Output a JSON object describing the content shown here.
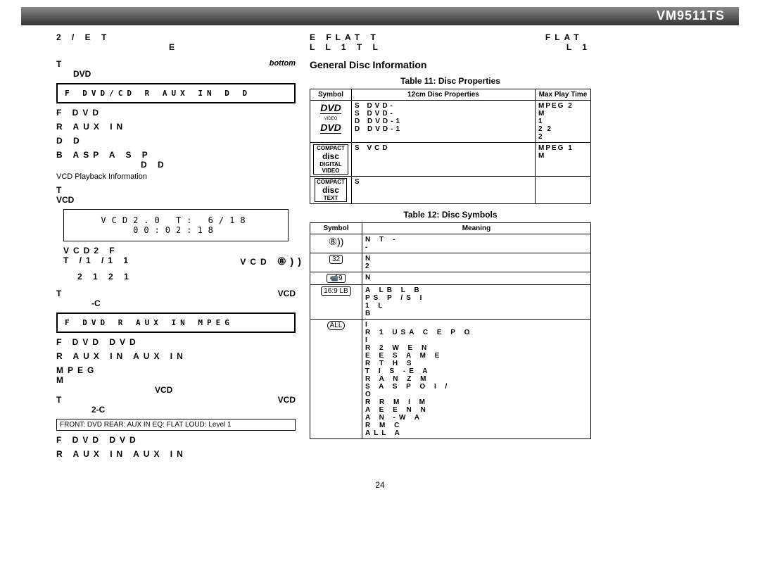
{
  "header": {
    "model": "VM9511TS"
  },
  "banner": {
    "left_top": "2 /  E   T",
    "left_sub_right": "E",
    "right_t1": "E   FLAT   T",
    "right_t2": "L   L   1   T   L",
    "right_t3": "FLAT",
    "right_t4": "L   1"
  },
  "left": {
    "t_line": "T",
    "bottom_word": "bottom",
    "dvd_line": "DVD",
    "box1": "F    DVD/CD    R     AUX IN     D    D",
    "f_dvd": "F    DVD",
    "r_aux": "R    AUX IN",
    "d_d": "D    D",
    "b_line": "B               ASP   A       S      P",
    "b_sub": "D    D",
    "vcd_note": "VCD Playback Information",
    "t2": "T",
    "vcd": "VCD",
    "osd": "VCD2.0    T: 6/18     00:02:18",
    "vcd2_line": "VCD2    F",
    "t1_line": "T  /1      /1                    1",
    "vcd_right": "VCD",
    "r21a": "2 1        2 1",
    "t_vcd1": "T",
    "t_vcd1_r": "VCD",
    "dash_c": "-C",
    "box2": "F    DVD   R   AUX IN       MPEG",
    "f_dvd2": "F    DVD   DVD",
    "r_aux2": "R    AUX IN   AUX IN",
    "mpeg": "MPEG",
    "m": "M",
    "vcd_alone": "VCD",
    "t_vcd2": "T",
    "t_vcd2_r": "VCD",
    "two_c": "2-C",
    "lcd_thin": "FRONT: DVD   REAR: AUX IN   EQ: FLAT   LOUD: Level 1",
    "f_dvd3": "F    DVD   DVD",
    "r_aux3": "R    AUX IN   AUX IN"
  },
  "right": {
    "gdi_title": "General Disc Information",
    "table11_caption": "Table 11: Disc Properties",
    "t11_h1": "Symbol",
    "t11_h2": "12cm Disc Properties",
    "t11_h3": "Max Play Time",
    "t11_r1c2": "S                          DVD-\nS                          DVD-\nD                          DVD-1\nD                          DVD-1",
    "t11_r1c3": "MPEG 2\nM\n1\n2 2\n2",
    "t11_r2c2": "S                         VCD",
    "t11_r2c3": "MPEG 1\nM",
    "t11_r3c2": "S",
    "table12_caption": "Table 12: Disc Symbols",
    "t12_h1": "Symbol",
    "t12_h2": "Meaning",
    "sound_sym": "⑧))",
    "sound_num": "8",
    "chapter_sym": "32",
    "camera_sym": "9",
    "lb_sym": "16:9 LB",
    "globe_sym": "ALL",
    "t12_r1": "N                              T       -\n                                        -",
    "t12_r2": "N\n                  2",
    "t12_r3": "N",
    "t12_r4": "A                   LB              L          B\n    PS            P  /S     I\n              1                                L\nB",
    "t12_r5": "I\n   R        1  USA   C        E    P         O\nI\n   R        2          W      E          N\n   E        E        S       A       M        E\n   R          T         H          S\n   T          I          S    -E  A\n   R          A          N    Z         M\n   S       A        S        P        O       I     /\nO\n   R             R         M         I        M\n   A        E       E       N               N\n   A        N   -W A\n   R          M         C\nALL   A"
  },
  "page_number": "24"
}
